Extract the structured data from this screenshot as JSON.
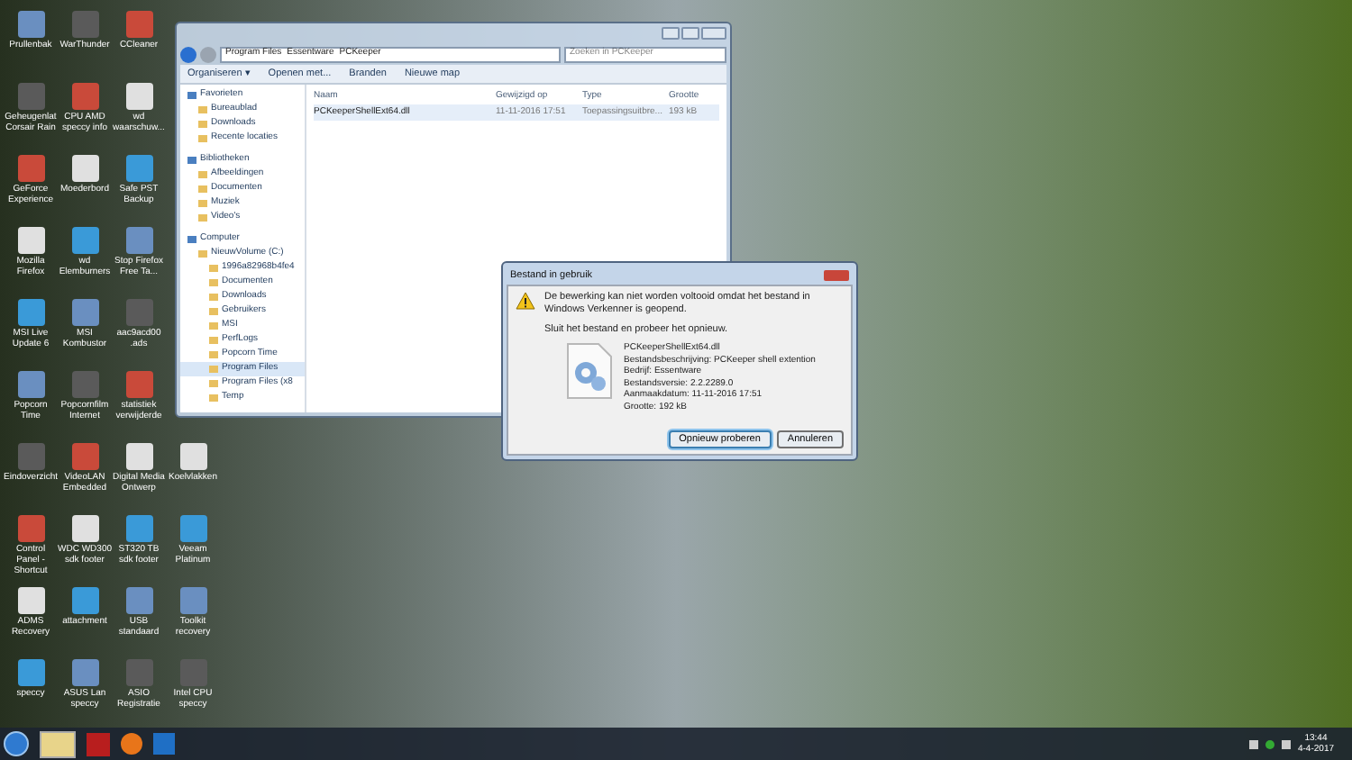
{
  "desktop_icons": [
    [
      {
        "label": "Prullenbak"
      },
      {
        "label": "Geheugenlat Corsair Rain"
      },
      {
        "label": "GeForce Experience"
      },
      {
        "label": "Mozilla Firefox"
      },
      {
        "label": "MSI Live Update 6"
      },
      {
        "label": "Popcorn Time"
      },
      {
        "label": "Eindoverzicht"
      },
      {
        "label": "Control Panel - Shortcut"
      },
      {
        "label": "ADMS Recovery"
      },
      {
        "label": "speccy"
      }
    ],
    [
      {
        "label": "WarThunder"
      },
      {
        "label": "CPU AMD speccy info"
      },
      {
        "label": "Moederbord"
      },
      {
        "label": "wd Elemburners"
      },
      {
        "label": "MSI Kombustor"
      },
      {
        "label": "Popcornfilm Internet"
      },
      {
        "label": "VideoLAN Embedded"
      },
      {
        "label": "WDC WD300 sdk footer"
      },
      {
        "label": "attachment"
      },
      {
        "label": "ASUS Lan speccy"
      }
    ],
    [
      {
        "label": "CCleaner"
      },
      {
        "label": "wd waarschuw..."
      },
      {
        "label": "Safe PST Backup"
      },
      {
        "label": "Stop Firefox Free Ta..."
      },
      {
        "label": "aac9acd00 .ads"
      },
      {
        "label": "statistiek verwijderde"
      },
      {
        "label": "Digital Media Ontwerp"
      },
      {
        "label": "ST320 TB sdk footer"
      },
      {
        "label": "USB standaard"
      },
      {
        "label": "ASIO Registratie"
      }
    ],
    [
      {
        "label": "Koelvlakken"
      },
      {
        "label": "Veeam Platinum"
      },
      {
        "label": "Toolkit recovery"
      },
      {
        "label": "Intel CPU speccy"
      }
    ]
  ],
  "explorer": {
    "breadcrumb": [
      "Program Files",
      "Essentware",
      "PCKeeper"
    ],
    "search": {
      "placeholder": "Zoeken in PCKeeper"
    },
    "toolbar": [
      "Organiseren ▾",
      "Openen met...",
      "Branden",
      "Nieuwe map"
    ],
    "nav": [
      {
        "label": "Favorieten",
        "selected": false,
        "children": [
          {
            "label": "Bureaublad",
            "selected": false
          },
          {
            "label": "Downloads",
            "selected": false
          },
          {
            "label": "Recente locaties",
            "selected": false
          }
        ]
      },
      {
        "label": "Bibliotheken",
        "selected": false,
        "children": [
          {
            "label": "Afbeeldingen",
            "selected": false
          },
          {
            "label": "Documenten",
            "selected": false
          },
          {
            "label": "Muziek",
            "selected": false
          },
          {
            "label": "Video's",
            "selected": false
          }
        ]
      },
      {
        "label": "Computer",
        "selected": false,
        "children": [
          {
            "label": "NieuwVolume (C:)",
            "selected": false,
            "children": [
              {
                "label": "1996a82968b4fe4",
                "selected": false
              },
              {
                "label": "Documenten",
                "selected": false
              },
              {
                "label": "Downloads",
                "selected": false
              },
              {
                "label": "Gebruikers",
                "selected": false
              },
              {
                "label": "MSI",
                "selected": false
              },
              {
                "label": "PerfLogs",
                "selected": false
              },
              {
                "label": "Popcorn Time",
                "selected": false
              },
              {
                "label": "Program Files",
                "selected": true
              },
              {
                "label": "Program Files (x8",
                "selected": false
              },
              {
                "label": "Temp",
                "selected": false
              }
            ]
          }
        ]
      }
    ],
    "columns": [
      "Naam",
      "Gewijzigd op",
      "Type",
      "Grootte"
    ],
    "rows": [
      {
        "cells": [
          "PCKeeperShellExt64.dll",
          "11-11-2016 17:51",
          "Toepassingsuitbre...",
          "193 kB"
        ],
        "selected": true
      }
    ]
  },
  "dialog": {
    "title": "Bestand in gebruik",
    "message": "De bewerking kan niet worden voltooid omdat het bestand in Windows Verkenner is geopend.",
    "instruction": "Sluit het bestand en probeer het opnieuw.",
    "file_info": [
      "PCKeeperShellExt64.dll",
      "Bestandsbeschrijving: PCKeeper shell extention",
      "Bedrijf: Essentware",
      "Bestandsversie: 2.2.2289.0",
      "Aanmaakdatum: 11-11-2016 17:51",
      "Grootte: 192 kB"
    ],
    "buttons": [
      {
        "label": "Opnieuw proberen",
        "selected": true
      },
      {
        "label": "Annuleren",
        "selected": false
      }
    ]
  },
  "taskbar": {
    "time": "13:44",
    "date": "4-4-2017"
  }
}
